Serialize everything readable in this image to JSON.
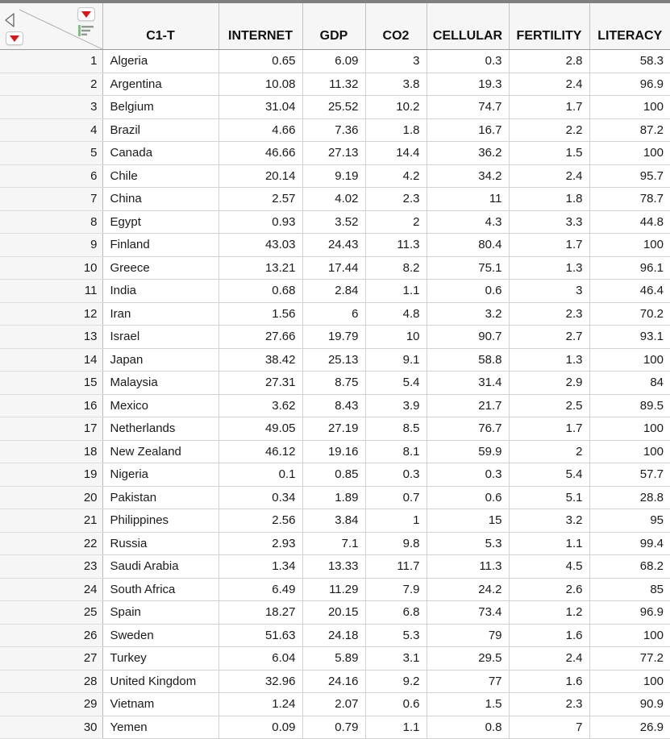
{
  "window": {
    "title": "JMP Data Table",
    "corner": {
      "collapse_icon": "triangle-left-icon",
      "table_menu_icon": "red-triangle-dropdown-icon",
      "rows_menu_icon": "red-triangle-dropdown-icon",
      "sort_icon": "sort-lines-icon"
    }
  },
  "table": {
    "row_number_header": "",
    "columns": [
      {
        "key": "country",
        "label": "C1-T",
        "align": "left"
      },
      {
        "key": "internet",
        "label": "INTERNET",
        "align": "right"
      },
      {
        "key": "gdp",
        "label": "GDP",
        "align": "right"
      },
      {
        "key": "co2",
        "label": "CO2",
        "align": "right"
      },
      {
        "key": "cellular",
        "label": "CELLULAR",
        "align": "right"
      },
      {
        "key": "fertility",
        "label": "FERTILITY",
        "align": "right"
      },
      {
        "key": "literacy",
        "label": "LITERACY",
        "align": "right"
      }
    ],
    "rows": [
      {
        "n": "1",
        "country": "Algeria",
        "internet": "0.65",
        "gdp": "6.09",
        "co2": "3",
        "cellular": "0.3",
        "fertility": "2.8",
        "literacy": "58.3"
      },
      {
        "n": "2",
        "country": "Argentina",
        "internet": "10.08",
        "gdp": "11.32",
        "co2": "3.8",
        "cellular": "19.3",
        "fertility": "2.4",
        "literacy": "96.9"
      },
      {
        "n": "3",
        "country": "Belgium",
        "internet": "31.04",
        "gdp": "25.52",
        "co2": "10.2",
        "cellular": "74.7",
        "fertility": "1.7",
        "literacy": "100"
      },
      {
        "n": "4",
        "country": "Brazil",
        "internet": "4.66",
        "gdp": "7.36",
        "co2": "1.8",
        "cellular": "16.7",
        "fertility": "2.2",
        "literacy": "87.2"
      },
      {
        "n": "5",
        "country": "Canada",
        "internet": "46.66",
        "gdp": "27.13",
        "co2": "14.4",
        "cellular": "36.2",
        "fertility": "1.5",
        "literacy": "100"
      },
      {
        "n": "6",
        "country": "Chile",
        "internet": "20.14",
        "gdp": "9.19",
        "co2": "4.2",
        "cellular": "34.2",
        "fertility": "2.4",
        "literacy": "95.7"
      },
      {
        "n": "7",
        "country": "China",
        "internet": "2.57",
        "gdp": "4.02",
        "co2": "2.3",
        "cellular": "11",
        "fertility": "1.8",
        "literacy": "78.7"
      },
      {
        "n": "8",
        "country": "Egypt",
        "internet": "0.93",
        "gdp": "3.52",
        "co2": "2",
        "cellular": "4.3",
        "fertility": "3.3",
        "literacy": "44.8"
      },
      {
        "n": "9",
        "country": "Finland",
        "internet": "43.03",
        "gdp": "24.43",
        "co2": "11.3",
        "cellular": "80.4",
        "fertility": "1.7",
        "literacy": "100"
      },
      {
        "n": "10",
        "country": "Greece",
        "internet": "13.21",
        "gdp": "17.44",
        "co2": "8.2",
        "cellular": "75.1",
        "fertility": "1.3",
        "literacy": "96.1"
      },
      {
        "n": "11",
        "country": "India",
        "internet": "0.68",
        "gdp": "2.84",
        "co2": "1.1",
        "cellular": "0.6",
        "fertility": "3",
        "literacy": "46.4"
      },
      {
        "n": "12",
        "country": "Iran",
        "internet": "1.56",
        "gdp": "6",
        "co2": "4.8",
        "cellular": "3.2",
        "fertility": "2.3",
        "literacy": "70.2"
      },
      {
        "n": "13",
        "country": "Israel",
        "internet": "27.66",
        "gdp": "19.79",
        "co2": "10",
        "cellular": "90.7",
        "fertility": "2.7",
        "literacy": "93.1"
      },
      {
        "n": "14",
        "country": "Japan",
        "internet": "38.42",
        "gdp": "25.13",
        "co2": "9.1",
        "cellular": "58.8",
        "fertility": "1.3",
        "literacy": "100"
      },
      {
        "n": "15",
        "country": "Malaysia",
        "internet": "27.31",
        "gdp": "8.75",
        "co2": "5.4",
        "cellular": "31.4",
        "fertility": "2.9",
        "literacy": "84"
      },
      {
        "n": "16",
        "country": "Mexico",
        "internet": "3.62",
        "gdp": "8.43",
        "co2": "3.9",
        "cellular": "21.7",
        "fertility": "2.5",
        "literacy": "89.5"
      },
      {
        "n": "17",
        "country": "Netherlands",
        "internet": "49.05",
        "gdp": "27.19",
        "co2": "8.5",
        "cellular": "76.7",
        "fertility": "1.7",
        "literacy": "100"
      },
      {
        "n": "18",
        "country": "New Zealand",
        "internet": "46.12",
        "gdp": "19.16",
        "co2": "8.1",
        "cellular": "59.9",
        "fertility": "2",
        "literacy": "100"
      },
      {
        "n": "19",
        "country": "Nigeria",
        "internet": "0.1",
        "gdp": "0.85",
        "co2": "0.3",
        "cellular": "0.3",
        "fertility": "5.4",
        "literacy": "57.7"
      },
      {
        "n": "20",
        "country": "Pakistan",
        "internet": "0.34",
        "gdp": "1.89",
        "co2": "0.7",
        "cellular": "0.6",
        "fertility": "5.1",
        "literacy": "28.8"
      },
      {
        "n": "21",
        "country": "Philippines",
        "internet": "2.56",
        "gdp": "3.84",
        "co2": "1",
        "cellular": "15",
        "fertility": "3.2",
        "literacy": "95"
      },
      {
        "n": "22",
        "country": "Russia",
        "internet": "2.93",
        "gdp": "7.1",
        "co2": "9.8",
        "cellular": "5.3",
        "fertility": "1.1",
        "literacy": "99.4"
      },
      {
        "n": "23",
        "country": "Saudi Arabia",
        "internet": "1.34",
        "gdp": "13.33",
        "co2": "11.7",
        "cellular": "11.3",
        "fertility": "4.5",
        "literacy": "68.2"
      },
      {
        "n": "24",
        "country": "South Africa",
        "internet": "6.49",
        "gdp": "11.29",
        "co2": "7.9",
        "cellular": "24.2",
        "fertility": "2.6",
        "literacy": "85"
      },
      {
        "n": "25",
        "country": "Spain",
        "internet": "18.27",
        "gdp": "20.15",
        "co2": "6.8",
        "cellular": "73.4",
        "fertility": "1.2",
        "literacy": "96.9"
      },
      {
        "n": "26",
        "country": "Sweden",
        "internet": "51.63",
        "gdp": "24.18",
        "co2": "5.3",
        "cellular": "79",
        "fertility": "1.6",
        "literacy": "100"
      },
      {
        "n": "27",
        "country": "Turkey",
        "internet": "6.04",
        "gdp": "5.89",
        "co2": "3.1",
        "cellular": "29.5",
        "fertility": "2.4",
        "literacy": "77.2"
      },
      {
        "n": "28",
        "country": "United Kingdom",
        "internet": "32.96",
        "gdp": "24.16",
        "co2": "9.2",
        "cellular": "77",
        "fertility": "1.6",
        "literacy": "100"
      },
      {
        "n": "29",
        "country": "Vietnam",
        "internet": "1.24",
        "gdp": "2.07",
        "co2": "0.6",
        "cellular": "1.5",
        "fertility": "2.3",
        "literacy": "90.9"
      },
      {
        "n": "30",
        "country": "Yemen",
        "internet": "0.09",
        "gdp": "0.79",
        "co2": "1.1",
        "cellular": "0.8",
        "fertility": "7",
        "literacy": "26.9"
      }
    ]
  },
  "colors": {
    "header_bg": "#f6f6f6",
    "grid": "#d2d2d2",
    "red_caret": "#d61a1a",
    "sort_green": "#5aa05a",
    "top_strip": "#808080"
  }
}
